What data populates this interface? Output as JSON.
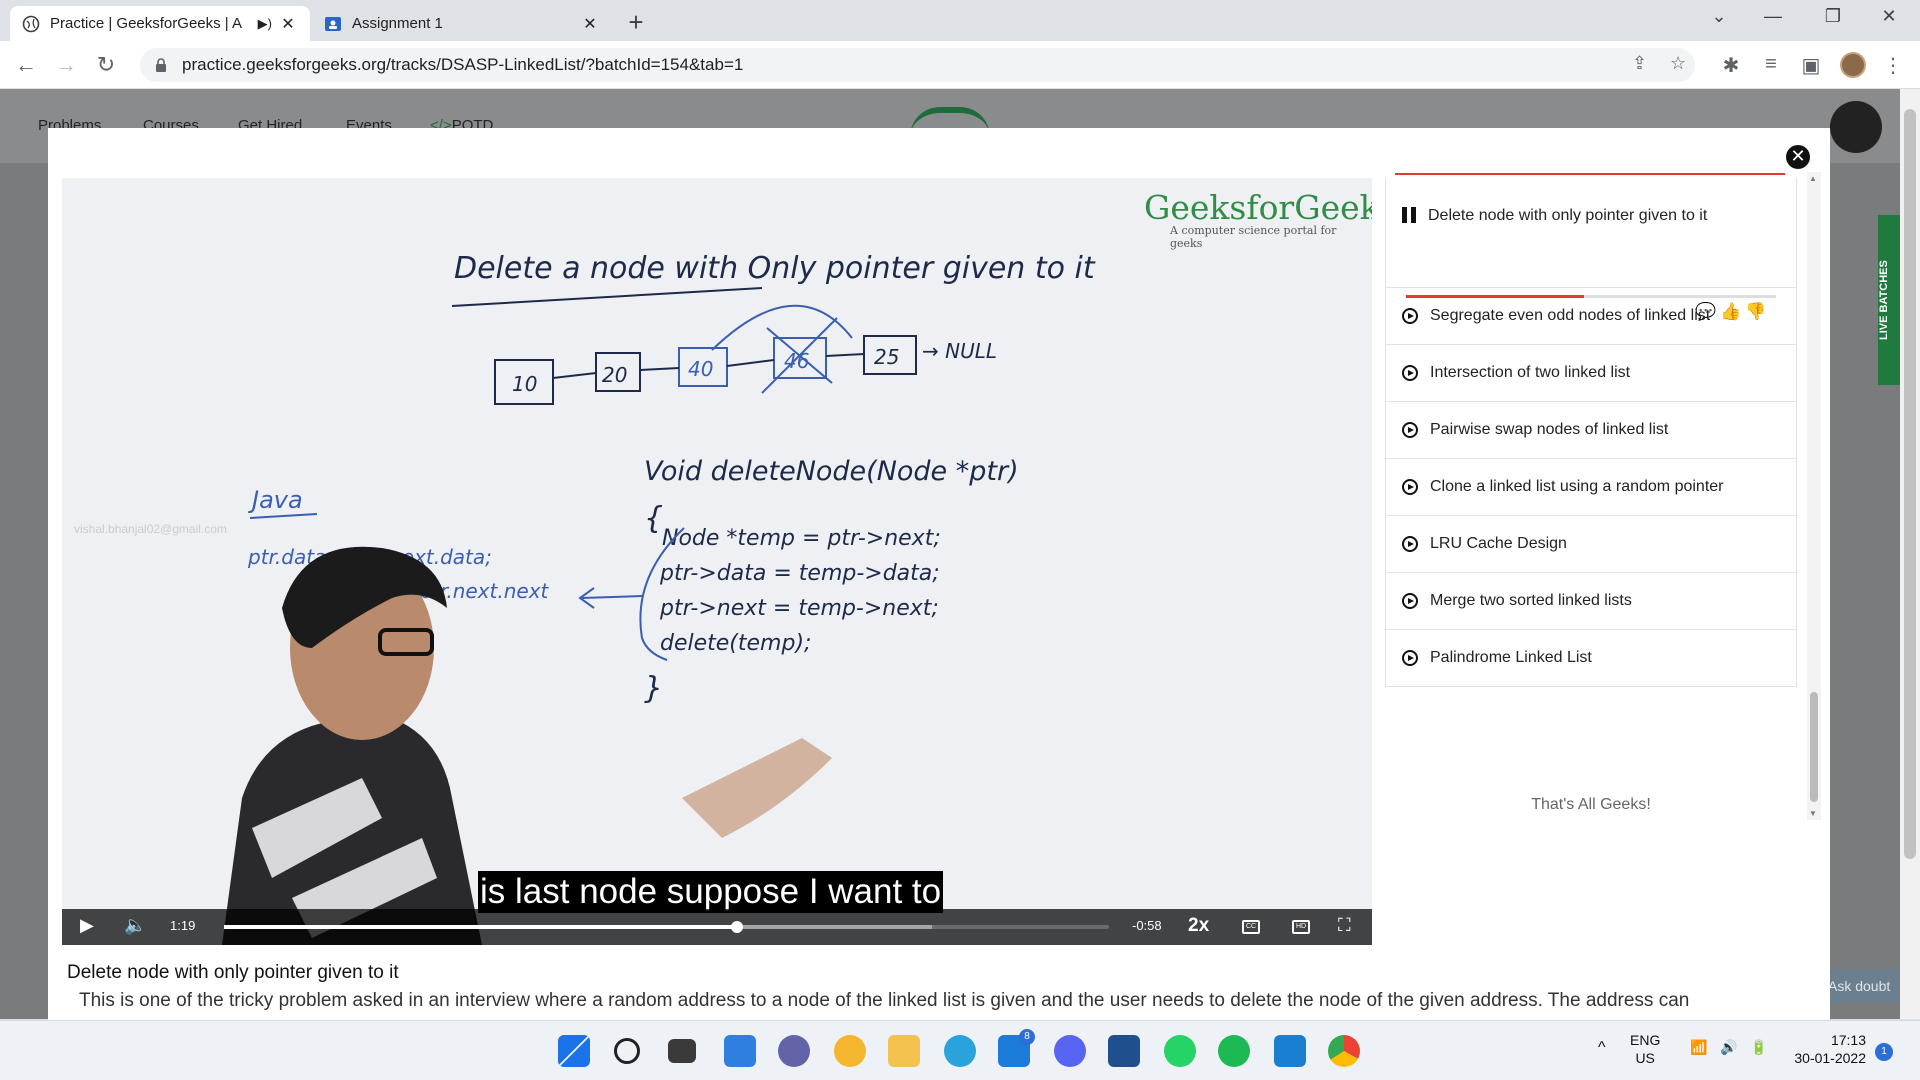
{
  "browser": {
    "tabs": [
      {
        "title": "Practice | GeeksforGeeks | A",
        "active": true
      },
      {
        "title": "Assignment 1",
        "active": false
      }
    ],
    "url": "practice.geeksforgeeks.org/tracks/DSASP-LinkedList/?batchId=154&tab=1"
  },
  "site": {
    "nav": [
      "Problems",
      "Courses",
      "Get Hired",
      "Events",
      "POTD"
    ],
    "live_batches": "LIVE BATCHES",
    "ask_doubt": "Ask doubt"
  },
  "video": {
    "watermark": "GeeksforGeeks",
    "watermark_tagline": "A computer science portal for geeks",
    "email_watermark": "vishal.bhanjal02@gmail.com",
    "subtitle": "is last node suppose I want to",
    "current_time": "1:19",
    "remaining_time": "-0:58",
    "speed": "2x",
    "progress": 0.58,
    "buffered": 0.8,
    "board": {
      "title": "Delete a node with Only pointer given to it",
      "nodes": [
        "10",
        "20",
        "40",
        "46",
        "25"
      ],
      "null_label": "→ NULL",
      "signature": "Void deleteNode(Node *ptr)",
      "open_brace": "{",
      "code_lines": [
        "Node *temp = ptr->next;",
        "ptr->data = temp->data;",
        "ptr->next = temp->next;",
        "delete(temp);"
      ],
      "close_brace": "}",
      "java_label": "Java",
      "java_lines": [
        "ptr.data = ptr.next.data;",
        "ptr.next = ptr.next.next"
      ]
    }
  },
  "lesson": {
    "title": "Delete node with only pointer given to it",
    "description": "This is one of the tricky problem asked in an interview where a random address to a node of the linked list is given and the user needs to delete the node of the given address. The address can"
  },
  "playlist": {
    "current": "Delete node with only pointer given to it",
    "current_progress": 0.48,
    "items": [
      "Segregate even odd nodes of linked list",
      "Intersection of two linked list",
      "Pairwise swap nodes of linked list",
      "Clone a linked list using a random pointer",
      "LRU Cache Design",
      "Merge two sorted linked lists",
      "Palindrome Linked List"
    ],
    "end_text": "That's All Geeks!"
  },
  "taskbar": {
    "mail_badge": "8",
    "lang": "ENG",
    "region": "US",
    "time": "17:13",
    "date": "30-01-2022",
    "notif_count": "1"
  },
  "colors": {
    "gfg_green": "#2f8d46",
    "accent_red": "#e53935",
    "ink_blue": "#3b5fb0"
  }
}
